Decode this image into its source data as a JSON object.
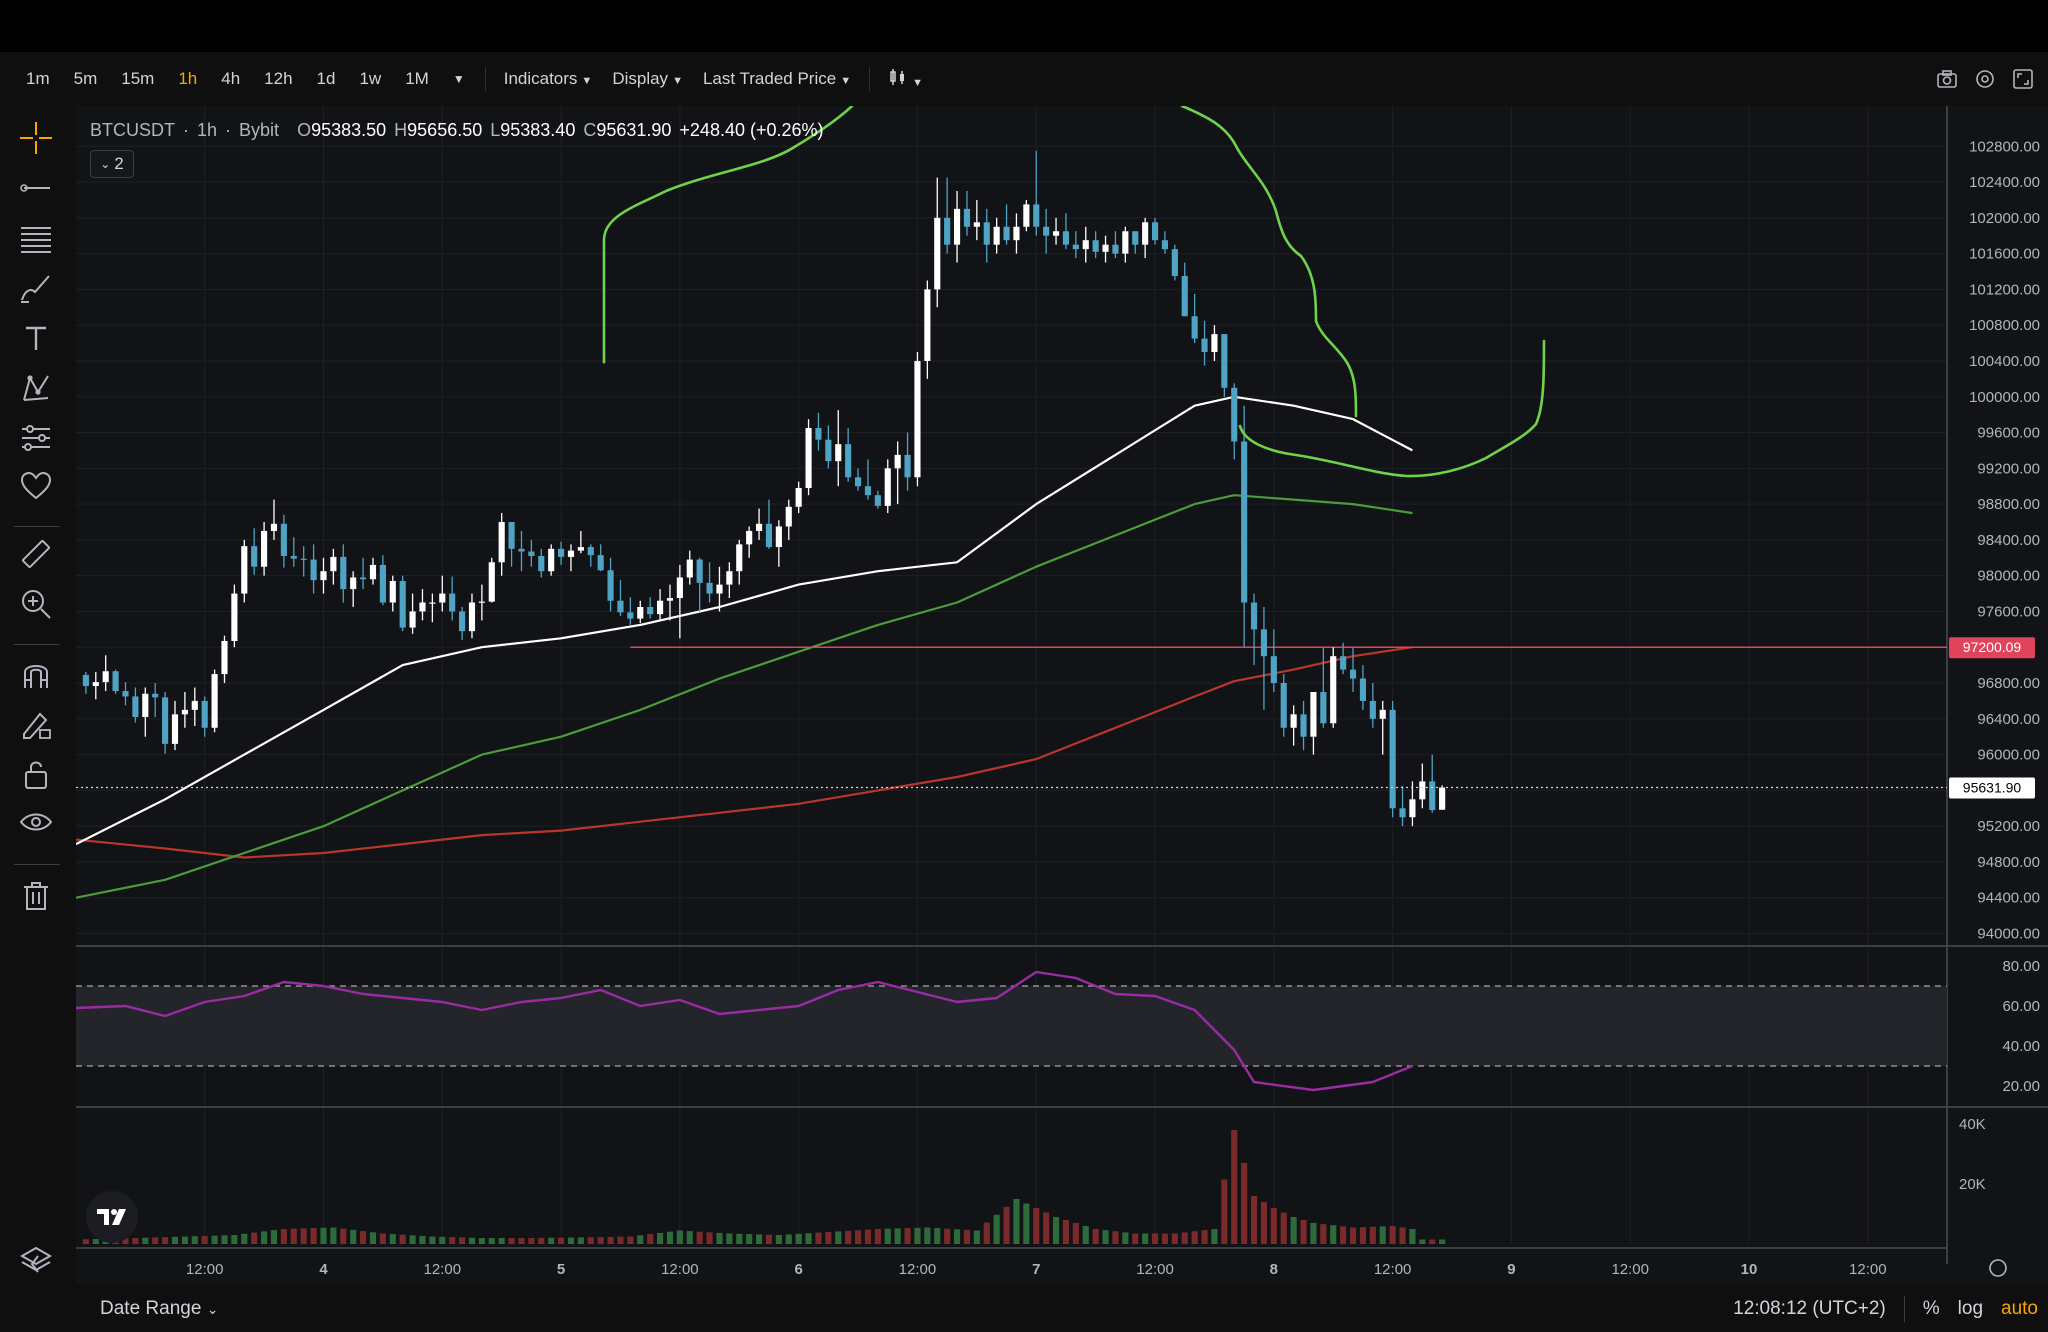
{
  "toolbar": {
    "timeframes": [
      "1m",
      "5m",
      "15m",
      "1h",
      "4h",
      "12h",
      "1d",
      "1w",
      "1M"
    ],
    "active_timeframe": "1h",
    "indicators_label": "Indicators",
    "display_label": "Display",
    "price_type_label": "Last Traded Price"
  },
  "legend": {
    "symbol": "BTCUSDT",
    "interval": "1h",
    "exchange": "Bybit",
    "o_key": "O",
    "o_val": "95383.50",
    "h_key": "H",
    "h_val": "95656.50",
    "l_key": "L",
    "l_val": "95383.40",
    "c_key": "C",
    "c_val": "95631.90",
    "change": "+248.40 (+0.26%)",
    "collapse_count": "2"
  },
  "bottom": {
    "date_range_label": "Date Range",
    "clock": "12:08:12 (UTC+2)",
    "percent_label": "%",
    "log_label": "log",
    "auto_label": "auto"
  },
  "colors": {
    "up": "#ffffff",
    "down": "#4fa3c4",
    "ma_white": "#ffffff",
    "ma_green": "#4c9b3c",
    "ma_red": "#b8362c",
    "rsi": "#9b2ba4",
    "level": "#e0445b",
    "drawing": "#6ed34a"
  },
  "chart_data": {
    "type": "candlestick",
    "symbol": "BTCUSDT",
    "price_axis": {
      "ticks": [
        94000,
        94400,
        94800,
        95200,
        95600,
        96000,
        96400,
        96800,
        97200,
        97600,
        98000,
        98400,
        98800,
        99200,
        99600,
        100000,
        100400,
        100800,
        101200,
        101600,
        102000,
        102400,
        102800
      ],
      "tick_labels": [
        "94000.00",
        "94400.00",
        "94800.00",
        "95200.00",
        "",
        "96000.00",
        "96400.00",
        "96800.00",
        "",
        "97600.00",
        "98000.00",
        "98400.00",
        "98800.00",
        "99200.00",
        "99600.00",
        "100000.00",
        "100400.00",
        "100800.00",
        "101200.00",
        "101600.00",
        "102000.00",
        "102400.00",
        "102800.00"
      ],
      "range": [
        93950,
        103250
      ]
    },
    "last_price": 95631.9,
    "last_price_label": "95631.90",
    "level_price": 97200.09,
    "level_label": "97200.09",
    "time_axis": {
      "labels": [
        "12:00",
        "4",
        "12:00",
        "5",
        "12:00",
        "6",
        "12:00",
        "7",
        "12:00",
        "8",
        "12:00",
        "9",
        "12:00",
        "10",
        "12:00"
      ],
      "hours": [
        12,
        24,
        36,
        48,
        60,
        72,
        84,
        96,
        108,
        120,
        132,
        144,
        156,
        168,
        180
      ],
      "range": [
        -1,
        188
      ]
    },
    "candles": [
      [
        96891,
        96924,
        96679,
        96767
      ],
      [
        96767,
        96924,
        96618,
        96810
      ],
      [
        96810,
        97110,
        96710,
        96932
      ],
      [
        96932,
        96950,
        96680,
        96710
      ],
      [
        96710,
        96810,
        96550,
        96650
      ],
      [
        96650,
        96750,
        96359,
        96420
      ],
      [
        96420,
        96750,
        96200,
        96680
      ],
      [
        96680,
        96800,
        96420,
        96640
      ],
      [
        96640,
        96700,
        96010,
        96120
      ],
      [
        96120,
        96600,
        96050,
        96450
      ],
      [
        96450,
        96700,
        96300,
        96500
      ],
      [
        96500,
        96750,
        96320,
        96600
      ],
      [
        96600,
        96650,
        96200,
        96300
      ],
      [
        96300,
        96950,
        96250,
        96900
      ],
      [
        96900,
        97330,
        96800,
        97270
      ],
      [
        97270,
        97900,
        97200,
        97800
      ],
      [
        97800,
        98400,
        97700,
        98330
      ],
      [
        98330,
        98530,
        98010,
        98100
      ],
      [
        98100,
        98600,
        98000,
        98500
      ],
      [
        98500,
        98850,
        98400,
        98580
      ],
      [
        98580,
        98680,
        98090,
        98220
      ],
      [
        98220,
        98430,
        98100,
        98190
      ],
      [
        98190,
        98330,
        97990,
        98180
      ],
      [
        98180,
        98350,
        97800,
        97950
      ],
      [
        97950,
        98200,
        97800,
        98050
      ],
      [
        98050,
        98300,
        97900,
        98210
      ],
      [
        98210,
        98350,
        97700,
        97850
      ],
      [
        97850,
        98050,
        97650,
        97980
      ],
      [
        97980,
        98200,
        97850,
        97960
      ],
      [
        97960,
        98200,
        97900,
        98120
      ],
      [
        98120,
        98230,
        97670,
        97700
      ],
      [
        97700,
        98000,
        97600,
        97940
      ],
      [
        97940,
        98000,
        97380,
        97420
      ],
      [
        97420,
        97800,
        97350,
        97600
      ],
      [
        97600,
        97850,
        97500,
        97700
      ],
      [
        97700,
        97800,
        97480,
        97700
      ],
      [
        97700,
        98000,
        97600,
        97800
      ],
      [
        97800,
        97990,
        97500,
        97600
      ],
      [
        97600,
        97650,
        97280,
        97380
      ],
      [
        97380,
        97800,
        97300,
        97700
      ],
      [
        97700,
        97900,
        97500,
        97710
      ],
      [
        97710,
        98200,
        97700,
        98150
      ],
      [
        98150,
        98700,
        98000,
        98600
      ],
      [
        98600,
        98600,
        98100,
        98300
      ],
      [
        98300,
        98500,
        98050,
        98270
      ],
      [
        98270,
        98400,
        98100,
        98220
      ],
      [
        98220,
        98300,
        97980,
        98050
      ],
      [
        98050,
        98350,
        98000,
        98300
      ],
      [
        98300,
        98380,
        98120,
        98210
      ],
      [
        98210,
        98350,
        98050,
        98280
      ],
      [
        98280,
        98500,
        98250,
        98320
      ],
      [
        98320,
        98350,
        98100,
        98230
      ],
      [
        98230,
        98350,
        98050,
        98060
      ],
      [
        98060,
        98200,
        97600,
        97720
      ],
      [
        97720,
        97950,
        97550,
        97590
      ],
      [
        97590,
        97760,
        97450,
        97520
      ],
      [
        97520,
        97720,
        97470,
        97650
      ],
      [
        97650,
        97760,
        97520,
        97570
      ],
      [
        97570,
        97850,
        97500,
        97720
      ],
      [
        97720,
        97900,
        97500,
        97750
      ],
      [
        97750,
        98120,
        97300,
        97980
      ],
      [
        97980,
        98280,
        97900,
        98180
      ],
      [
        98180,
        98200,
        97600,
        97920
      ],
      [
        97920,
        98150,
        97700,
        97800
      ],
      [
        97800,
        98100,
        97600,
        97900
      ],
      [
        97900,
        98150,
        97750,
        98050
      ],
      [
        98050,
        98400,
        97900,
        98350
      ],
      [
        98350,
        98550,
        98200,
        98500
      ],
      [
        98500,
        98750,
        98400,
        98580
      ],
      [
        98580,
        98850,
        98300,
        98320
      ],
      [
        98320,
        98620,
        98100,
        98550
      ],
      [
        98550,
        98850,
        98400,
        98770
      ],
      [
        98770,
        99050,
        98700,
        98980
      ],
      [
        98980,
        99750,
        98900,
        99650
      ],
      [
        99650,
        99820,
        99400,
        99520
      ],
      [
        99520,
        99680,
        99200,
        99280
      ],
      [
        99280,
        99850,
        99000,
        99470
      ],
      [
        99470,
        99650,
        99050,
        99100
      ],
      [
        99100,
        99200,
        98950,
        99000
      ],
      [
        99000,
        99300,
        98850,
        98900
      ],
      [
        98900,
        98950,
        98750,
        98780
      ],
      [
        98780,
        99300,
        98700,
        99200
      ],
      [
        99200,
        99500,
        98800,
        99350
      ],
      [
        99350,
        99600,
        98950,
        99100
      ],
      [
        99100,
        100500,
        99000,
        100400
      ],
      [
        100400,
        101300,
        100200,
        101200
      ],
      [
        101200,
        102450,
        101000,
        102000
      ],
      [
        102000,
        102450,
        101600,
        101700
      ],
      [
        101700,
        102300,
        101500,
        102100
      ],
      [
        102100,
        102300,
        101800,
        101900
      ],
      [
        101900,
        102200,
        101750,
        101950
      ],
      [
        101950,
        102100,
        101500,
        101700
      ],
      [
        101700,
        102000,
        101600,
        101900
      ],
      [
        101900,
        102150,
        101700,
        101750
      ],
      [
        101750,
        102050,
        101600,
        101900
      ],
      [
        101900,
        102200,
        101850,
        102150
      ],
      [
        102150,
        102750,
        101800,
        101900
      ],
      [
        101900,
        102100,
        101600,
        101800
      ],
      [
        101800,
        102000,
        101700,
        101850
      ],
      [
        101850,
        102050,
        101650,
        101700
      ],
      [
        101700,
        101850,
        101550,
        101650
      ],
      [
        101650,
        101900,
        101500,
        101750
      ],
      [
        101750,
        101850,
        101550,
        101620
      ],
      [
        101620,
        101800,
        101500,
        101700
      ],
      [
        101700,
        101850,
        101550,
        101600
      ],
      [
        101600,
        101900,
        101500,
        101850
      ],
      [
        101850,
        101850,
        101600,
        101700
      ],
      [
        101700,
        102000,
        101550,
        101950
      ],
      [
        101950,
        102000,
        101700,
        101750
      ],
      [
        101750,
        101850,
        101600,
        101650
      ],
      [
        101650,
        101700,
        101300,
        101350
      ],
      [
        101350,
        101500,
        100900,
        100900
      ],
      [
        100900,
        101150,
        100600,
        100650
      ],
      [
        100650,
        100850,
        100350,
        100500
      ],
      [
        100500,
        100800,
        100400,
        100700
      ],
      [
        100700,
        100700,
        100000,
        100100
      ],
      [
        100100,
        100150,
        99300,
        99500
      ],
      [
        99500,
        99900,
        97200,
        97700
      ],
      [
        97700,
        97800,
        97000,
        97400
      ],
      [
        97400,
        97650,
        96500,
        97100
      ],
      [
        97100,
        97400,
        96700,
        96800
      ],
      [
        96800,
        96900,
        96200,
        96300
      ],
      [
        96300,
        96550,
        96100,
        96450
      ],
      [
        96450,
        96600,
        96050,
        96200
      ],
      [
        96200,
        96700,
        96000,
        96700
      ],
      [
        96700,
        97200,
        96300,
        96350
      ],
      [
        96350,
        97200,
        96300,
        97100
      ],
      [
        97100,
        97250,
        96900,
        96950
      ],
      [
        96950,
        97200,
        96700,
        96850
      ],
      [
        96850,
        97000,
        96500,
        96600
      ],
      [
        96600,
        96800,
        96300,
        96400
      ],
      [
        96400,
        96600,
        96000,
        96500
      ],
      [
        96500,
        96600,
        95300,
        95400
      ],
      [
        95400,
        95650,
        95200,
        95300
      ],
      [
        95300,
        95700,
        95200,
        95500
      ],
      [
        95500,
        95900,
        95400,
        95700
      ],
      [
        95700,
        96000,
        95350,
        95380
      ],
      [
        95383.5,
        95656.5,
        95383.4,
        95631.9
      ]
    ],
    "ma_white": [
      [
        -1,
        95000
      ],
      [
        8,
        95500
      ],
      [
        16,
        96000
      ],
      [
        24,
        96500
      ],
      [
        32,
        97000
      ],
      [
        40,
        97200
      ],
      [
        48,
        97300
      ],
      [
        56,
        97450
      ],
      [
        64,
        97650
      ],
      [
        72,
        97900
      ],
      [
        80,
        98050
      ],
      [
        88,
        98150
      ],
      [
        96,
        98800
      ],
      [
        104,
        99350
      ],
      [
        112,
        99900
      ],
      [
        116,
        100000
      ],
      [
        122,
        99900
      ],
      [
        128,
        99750
      ],
      [
        134,
        99400
      ]
    ],
    "ma_green": [
      [
        -1,
        94400
      ],
      [
        8,
        94600
      ],
      [
        16,
        94900
      ],
      [
        24,
        95200
      ],
      [
        32,
        95600
      ],
      [
        40,
        96000
      ],
      [
        48,
        96200
      ],
      [
        56,
        96500
      ],
      [
        64,
        96850
      ],
      [
        72,
        97150
      ],
      [
        80,
        97450
      ],
      [
        88,
        97700
      ],
      [
        96,
        98100
      ],
      [
        104,
        98450
      ],
      [
        112,
        98800
      ],
      [
        116,
        98900
      ],
      [
        122,
        98850
      ],
      [
        128,
        98800
      ],
      [
        134,
        98700
      ]
    ],
    "ma_red": [
      [
        -1,
        95050
      ],
      [
        8,
        94950
      ],
      [
        16,
        94850
      ],
      [
        24,
        94900
      ],
      [
        32,
        95000
      ],
      [
        40,
        95100
      ],
      [
        48,
        95150
      ],
      [
        56,
        95250
      ],
      [
        64,
        95350
      ],
      [
        72,
        95450
      ],
      [
        80,
        95600
      ],
      [
        88,
        95750
      ],
      [
        96,
        95950
      ],
      [
        104,
        96300
      ],
      [
        112,
        96650
      ],
      [
        116,
        96820
      ],
      [
        122,
        96950
      ],
      [
        128,
        97100
      ],
      [
        134,
        97200
      ]
    ],
    "level_start_hour": 55,
    "level_end_hour": 134,
    "rsi": {
      "ticks": [
        20,
        40,
        60,
        80
      ],
      "tick_labels": [
        "20.00",
        "40.00",
        "60.00",
        "80.00"
      ],
      "upper": 70,
      "lower": 30,
      "range": [
        15,
        85
      ],
      "values": [
        [
          -1,
          59
        ],
        [
          4,
          60
        ],
        [
          8,
          55
        ],
        [
          12,
          62
        ],
        [
          16,
          65
        ],
        [
          20,
          72
        ],
        [
          24,
          70
        ],
        [
          28,
          66
        ],
        [
          32,
          64
        ],
        [
          36,
          62
        ],
        [
          40,
          58
        ],
        [
          44,
          62
        ],
        [
          48,
          64
        ],
        [
          52,
          68
        ],
        [
          56,
          60
        ],
        [
          60,
          63
        ],
        [
          64,
          56
        ],
        [
          68,
          58
        ],
        [
          72,
          60
        ],
        [
          76,
          68
        ],
        [
          80,
          72
        ],
        [
          84,
          67
        ],
        [
          88,
          62
        ],
        [
          92,
          64
        ],
        [
          96,
          77
        ],
        [
          100,
          74
        ],
        [
          104,
          66
        ],
        [
          108,
          65
        ],
        [
          112,
          58
        ],
        [
          116,
          38
        ],
        [
          118,
          22
        ],
        [
          124,
          18
        ],
        [
          130,
          22
        ],
        [
          134,
          30
        ]
      ]
    },
    "volume": {
      "ticks": [
        20000,
        40000
      ],
      "tick_labels": [
        "20K",
        "40K"
      ],
      "range": [
        0,
        42000
      ],
      "bars": [
        [
          -1,
          1500
        ],
        [
          5,
          2000
        ],
        [
          10,
          2500
        ],
        [
          15,
          3000
        ],
        [
          20,
          5000
        ],
        [
          25,
          5500
        ],
        [
          30,
          3500
        ],
        [
          35,
          2500
        ],
        [
          40,
          2000
        ],
        [
          45,
          2000
        ],
        [
          50,
          2200
        ],
        [
          55,
          2500
        ],
        [
          60,
          4500
        ],
        [
          65,
          3500
        ],
        [
          70,
          3000
        ],
        [
          75,
          4000
        ],
        [
          80,
          5000
        ],
        [
          85,
          5500
        ],
        [
          90,
          4500
        ],
        [
          94,
          15000
        ],
        [
          98,
          9000
        ],
        [
          102,
          5000
        ],
        [
          106,
          3500
        ],
        [
          110,
          3500
        ],
        [
          114,
          5000
        ],
        [
          116,
          38000
        ],
        [
          118,
          16000
        ],
        [
          120,
          12000
        ],
        [
          122,
          9000
        ],
        [
          124,
          7000
        ],
        [
          128,
          5500
        ],
        [
          132,
          6000
        ],
        [
          134,
          5000
        ]
      ]
    },
    "drawings": "hand-drawn green curves"
  }
}
